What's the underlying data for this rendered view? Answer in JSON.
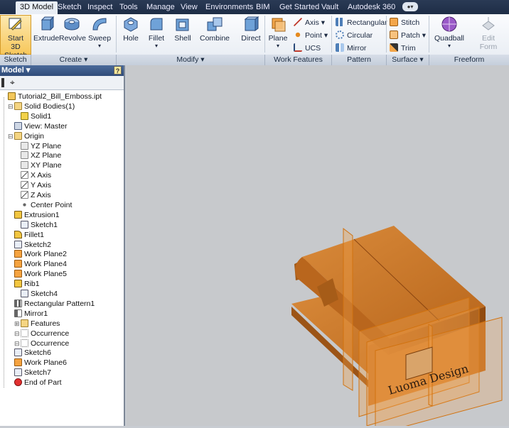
{
  "tabs": [
    "3D Model",
    "Sketch",
    "Inspect",
    "Tools",
    "Manage",
    "View",
    "Environments",
    "BIM",
    "Get Started",
    "Vault",
    "Autodesk 360"
  ],
  "ribbon": {
    "sketch": {
      "start_line1": "Start",
      "start_line2": "3D Sketch",
      "label": "Sketch"
    },
    "create": {
      "extrude": "Extrude",
      "revolve": "Revolve",
      "sweep": "Sweep",
      "label": "Create"
    },
    "modify": {
      "hole": "Hole",
      "fillet": "Fillet",
      "shell": "Shell",
      "combine": "Combine",
      "direct": "Direct",
      "label": "Modify"
    },
    "work_features": {
      "plane": "Plane",
      "axis": "Axis",
      "point": "Point",
      "ucs": "UCS",
      "label": "Work Features"
    },
    "pattern": {
      "rectangular": "Rectangular",
      "circular": "Circular",
      "mirror": "Mirror",
      "label": "Pattern"
    },
    "surface": {
      "stitch": "Stitch",
      "patch": "Patch",
      "trim": "Trim",
      "label": "Surface"
    },
    "freeform": {
      "quadball": "Quadball",
      "edit_form_line1": "Edit",
      "edit_form_line2": "Form",
      "label": "Freeform"
    }
  },
  "browser": {
    "title": "Model",
    "items": [
      {
        "label": "Tutorial2_Bill_Emboss.ipt",
        "icon": "part-icon"
      },
      {
        "label": "Solid Bodies(1)",
        "icon": "folder-icon"
      },
      {
        "label": "Solid1",
        "icon": "solid-icon"
      },
      {
        "label": "View: Master",
        "icon": "view-icon"
      },
      {
        "label": "Origin",
        "icon": "folder-icon"
      },
      {
        "label": "YZ Plane",
        "icon": "plane-icon"
      },
      {
        "label": "XZ Plane",
        "icon": "plane-icon"
      },
      {
        "label": "XY Plane",
        "icon": "plane-icon"
      },
      {
        "label": "X Axis",
        "icon": "axis-icon"
      },
      {
        "label": "Y Axis",
        "icon": "axis-icon"
      },
      {
        "label": "Z Axis",
        "icon": "axis-icon"
      },
      {
        "label": "Center Point",
        "icon": "point-icon"
      },
      {
        "label": "Extrusion1",
        "icon": "extrude-icon"
      },
      {
        "label": "Sketch1",
        "icon": "sketch-icon"
      },
      {
        "label": "Fillet1",
        "icon": "fillet-icon"
      },
      {
        "label": "Sketch2",
        "icon": "sketch-icon"
      },
      {
        "label": "Work Plane2",
        "icon": "workplane-icon"
      },
      {
        "label": "Work Plane4",
        "icon": "workplane-icon"
      },
      {
        "label": "Work Plane5",
        "icon": "workplane-icon"
      },
      {
        "label": "Rib1",
        "icon": "rib-icon"
      },
      {
        "label": "Sketch4",
        "icon": "sketch-icon"
      },
      {
        "label": "Rectangular Pattern1",
        "icon": "pattern-icon"
      },
      {
        "label": "Mirror1",
        "icon": "mirror-icon"
      },
      {
        "label": "Features",
        "icon": "folder-icon"
      },
      {
        "label": "Occurrence",
        "icon": "occurrence-icon"
      },
      {
        "label": "Occurrence",
        "icon": "occurrence-icon"
      },
      {
        "label": "Sketch6",
        "icon": "sketch-icon"
      },
      {
        "label": "Work Plane6",
        "icon": "workplane-icon"
      },
      {
        "label": "Sketch7",
        "icon": "sketch-icon"
      },
      {
        "label": "End of Part",
        "icon": "end-of-part-icon"
      }
    ]
  },
  "model": {
    "emboss_text": "Luoma Design",
    "body_color": "#c8711e"
  }
}
